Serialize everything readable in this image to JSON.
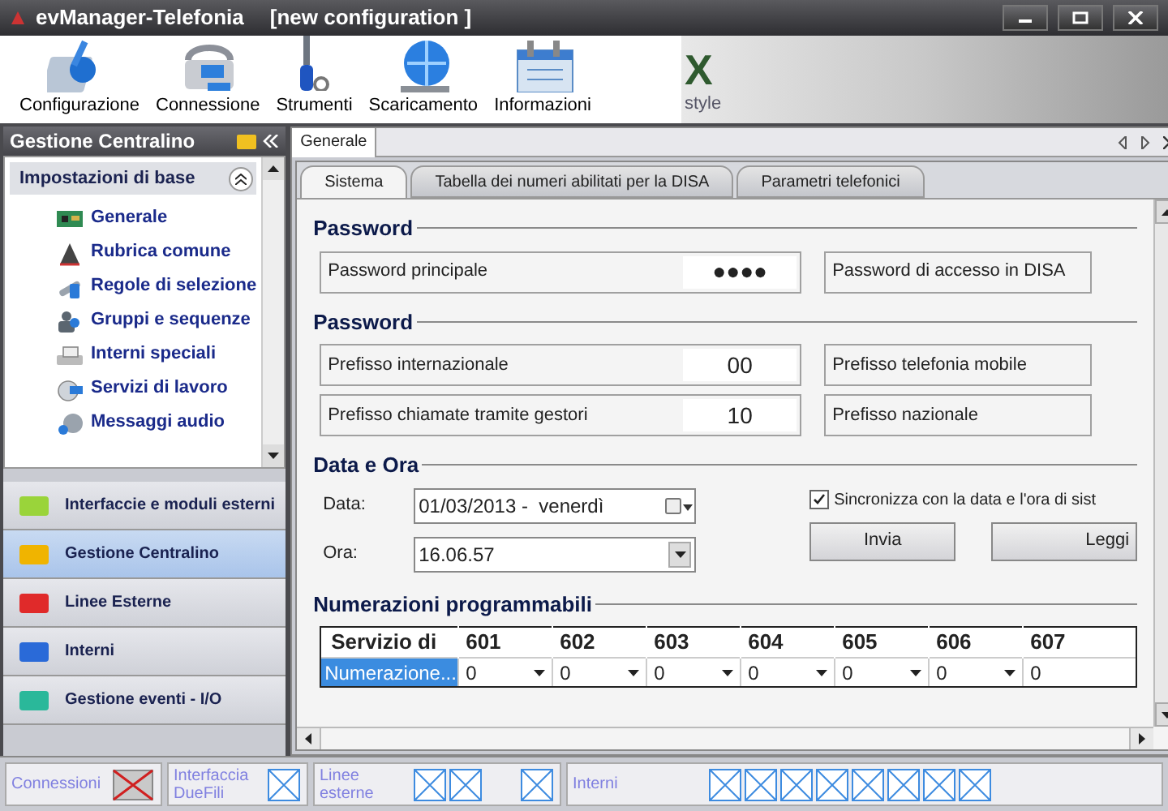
{
  "window": {
    "title": "evManager-Telefonia",
    "subtitle": "[new configuration ]"
  },
  "toolbar": [
    {
      "label": "Configurazione"
    },
    {
      "label": "Connessione"
    },
    {
      "label": "Strumenti"
    },
    {
      "label": "Scaricamento"
    },
    {
      "label": "Informazioni"
    }
  ],
  "banner": {
    "mark": "X",
    "tagline": "style"
  },
  "sidebar": {
    "title": "Gestione Centralino",
    "section": "Impostazioni di base",
    "expanded": true,
    "items": [
      {
        "label": "Generale"
      },
      {
        "label": "Rubrica comune"
      },
      {
        "label": "Regole di selezione"
      },
      {
        "label": "Gruppi e sequenze"
      },
      {
        "label": "Interni speciali"
      },
      {
        "label": "Servizi di lavoro"
      },
      {
        "label": "Messaggi audio"
      }
    ]
  },
  "nav": [
    {
      "label": "Interfaccie e moduli esterni",
      "color": "#9ad43a",
      "selected": false
    },
    {
      "label": "Gestione Centralino",
      "color": "#f0b400",
      "selected": true
    },
    {
      "label": "Linee Esterne",
      "color": "#e02a2a",
      "selected": false
    },
    {
      "label": "Interni",
      "color": "#2a6ad8",
      "selected": false
    },
    {
      "label": "Gestione eventi - I/O",
      "color": "#2ab89a",
      "selected": false
    }
  ],
  "document_tab": "Generale",
  "tabs": [
    {
      "label": "Sistema",
      "selected": true
    },
    {
      "label": "Tabella dei numeri abilitati per la DISA",
      "selected": false
    },
    {
      "label": "Parametri telefonici",
      "selected": false
    }
  ],
  "groups": [
    {
      "title": "Password",
      "rows": [
        [
          {
            "label": "Password principale",
            "value": "●●●●"
          },
          {
            "label": "Password di accesso in DISA"
          }
        ]
      ]
    },
    {
      "title": "Password",
      "rows": [
        [
          {
            "label": "Prefisso internazionale",
            "value": "00"
          },
          {
            "label": "Prefisso telefonia mobile"
          }
        ],
        [
          {
            "label": "Prefisso chiamate tramite gestori",
            "value": "10"
          },
          {
            "label": "Prefisso nazionale"
          }
        ]
      ]
    }
  ],
  "date_time": {
    "title": "Data e Ora",
    "date_label": "Data:",
    "date_value": "01/03/2013 -  venerdì",
    "time_label": "Ora:",
    "time_value": "16.06.57",
    "sync": {
      "label": "Sincronizza con la data e l'ora di sist",
      "checked": true
    },
    "buttons": [
      "Invia",
      "Leggi"
    ]
  },
  "numbering": {
    "title": "Numerazioni programmabili",
    "columns": [
      "Servizio di",
      "601",
      "602",
      "603",
      "604",
      "605",
      "606",
      "607"
    ],
    "rows": [
      {
        "selected": true,
        "cells": [
          "Numerazione...",
          "0",
          "0",
          "0",
          "0",
          "0",
          "0",
          "0"
        ]
      }
    ]
  },
  "status_bar": [
    {
      "label": "Connessioni",
      "indicators": [
        {
          "kind": "disconnected"
        }
      ]
    },
    {
      "label": "Interfaccia DueFili",
      "indicators": [
        {
          "kind": "port"
        }
      ]
    },
    {
      "label": "Linee esterne",
      "indicators": [
        {
          "kind": "port"
        },
        {
          "kind": "port"
        },
        {
          "kind": "gap"
        },
        {
          "kind": "port"
        }
      ]
    },
    {
      "label": "Interni",
      "indicators": [
        {
          "kind": "gap"
        },
        {
          "kind": "port"
        },
        {
          "kind": "port"
        },
        {
          "kind": "port"
        },
        {
          "kind": "port"
        },
        {
          "kind": "port"
        },
        {
          "kind": "port"
        },
        {
          "kind": "port"
        },
        {
          "kind": "port"
        }
      ]
    }
  ]
}
